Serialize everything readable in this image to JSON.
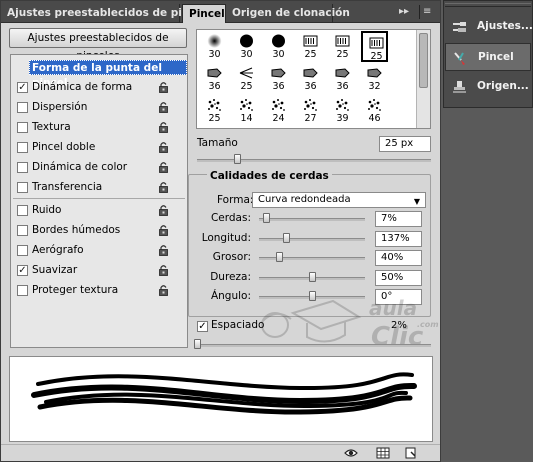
{
  "tabs": [
    {
      "label": "Ajustes preestablecidos de pinceles"
    },
    {
      "label": "Pincel"
    },
    {
      "label": "Origen de clonación"
    }
  ],
  "panel_controls": {
    "collapse": "▸▸",
    "menu": "≡"
  },
  "presets_button": "Ajustes preestablecidos de pinceles",
  "options": [
    {
      "label": "Forma de la punta del pincel",
      "checked": false,
      "header": true,
      "lock": false
    },
    {
      "label": "Dinámica de forma",
      "checked": true,
      "lock": true
    },
    {
      "label": "Dispersión",
      "checked": false,
      "lock": true
    },
    {
      "label": "Textura",
      "checked": false,
      "lock": true
    },
    {
      "label": "Pincel doble",
      "checked": false,
      "lock": true
    },
    {
      "label": "Dinámica de color",
      "checked": false,
      "lock": true
    },
    {
      "label": "Transferencia",
      "checked": false,
      "lock": true
    },
    {
      "label": "Ruido",
      "checked": false,
      "lock": true
    },
    {
      "label": "Bordes húmedos",
      "checked": false,
      "lock": true
    },
    {
      "label": "Aerógrafo",
      "checked": false,
      "lock": true
    },
    {
      "label": "Suavizar",
      "checked": true,
      "lock": true
    },
    {
      "label": "Proteger textura",
      "checked": false,
      "lock": true
    }
  ],
  "brushes": [
    {
      "size": "30",
      "glyph": "soft"
    },
    {
      "size": "30",
      "glyph": "hard"
    },
    {
      "size": "30",
      "glyph": "hard"
    },
    {
      "size": "25",
      "glyph": "bristle"
    },
    {
      "size": "25",
      "glyph": "bristle"
    },
    {
      "size": "25",
      "glyph": "bristle"
    },
    {
      "size": "36",
      "glyph": "flat"
    },
    {
      "size": "25",
      "glyph": "fan"
    },
    {
      "size": "36",
      "glyph": "flat"
    },
    {
      "size": "36",
      "glyph": "flat"
    },
    {
      "size": "36",
      "glyph": "flat"
    },
    {
      "size": "32",
      "glyph": "flat"
    },
    {
      "size": "25",
      "glyph": "spatter"
    },
    {
      "size": "14",
      "glyph": "spatter"
    },
    {
      "size": "24",
      "glyph": "spatter"
    },
    {
      "size": "27",
      "glyph": "spatter"
    },
    {
      "size": "39",
      "glyph": "spatter"
    },
    {
      "size": "46",
      "glyph": "spatter"
    }
  ],
  "size": {
    "label": "Tamaño",
    "value": "25 px",
    "fraction": 0.17
  },
  "bristle": {
    "title": "Calidades de cerdas",
    "shape_label": "Forma:",
    "shape_value": "Curva redondeada",
    "params": [
      {
        "label": "Cerdas:",
        "value": "7%",
        "fraction": 0.07
      },
      {
        "label": "Longitud:",
        "value": "137%",
        "fraction": 0.25
      },
      {
        "label": "Grosor:",
        "value": "40%",
        "fraction": 0.19
      },
      {
        "label": "Dureza:",
        "value": "50%",
        "fraction": 0.5
      },
      {
        "label": "Ángulo:",
        "value": "0°",
        "fraction": 0.5
      }
    ]
  },
  "spacing": {
    "label": "Espaciado",
    "checked": true,
    "value": "2%",
    "fraction": 0.0
  },
  "watermark": {
    "line1": "aula",
    "line2": "Clic",
    "suffix": ".com"
  },
  "dock": [
    {
      "label": "Ajustes...",
      "icon": "brush-presets-icon",
      "active": false
    },
    {
      "label": "Pincel",
      "icon": "brush-icon",
      "active": true
    },
    {
      "label": "Origen...",
      "icon": "clone-stamp-icon",
      "active": false
    }
  ],
  "colors": {
    "selection": "#2d67c8",
    "panel": "#d6d6d6",
    "dark_chrome": "#4a4a4a",
    "dock_active": "#6b6b6b"
  }
}
